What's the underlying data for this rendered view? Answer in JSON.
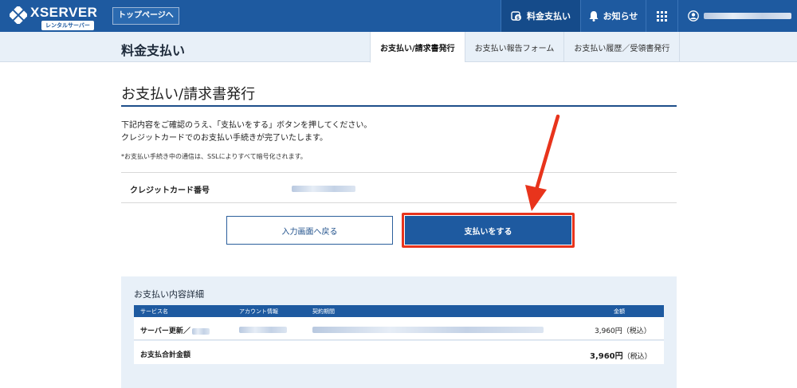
{
  "header": {
    "brand": "XSERVER",
    "brand_sub": "レンタルサーバー",
    "top_page_link": "トップページへ",
    "nav": [
      {
        "label": "料金支払い",
        "icon": "coin-icon",
        "active": true
      },
      {
        "label": "お知らせ",
        "icon": "bell-icon",
        "active": false
      }
    ]
  },
  "subheader": {
    "page_title": "料金支払い",
    "tabs": [
      {
        "label": "お支払い/請求書発行",
        "active": true
      },
      {
        "label": "お支払い報告フォーム",
        "active": false
      },
      {
        "label": "お支払い履歴／受領書発行",
        "active": false
      }
    ]
  },
  "main": {
    "section_title": "お支払い/請求書発行",
    "description_line1": "下記内容をご確認のうえ、「支払いをする」ボタンを押してください。",
    "description_line2": "クレジットカードでのお支払い手続きが完了いたします。",
    "note": "*お支払い手続き中の通信は、SSLによりすべて暗号化されます。",
    "card_label": "クレジットカード番号",
    "back_button": "入力画面へ戻る",
    "pay_button": "支払いをする"
  },
  "detail": {
    "title": "お支払い内容詳細",
    "columns": [
      "サービス名",
      "アカウント情報",
      "契約期間",
      "金額"
    ],
    "row_service": "サーバー更新／",
    "row_amount": "3,960円（税込）",
    "total_label": "お支払合計金額",
    "total_amount": "3,960円",
    "total_tax": "（税込）"
  },
  "colors": {
    "brand": "#1e5aa0",
    "highlight": "#e8341c"
  }
}
